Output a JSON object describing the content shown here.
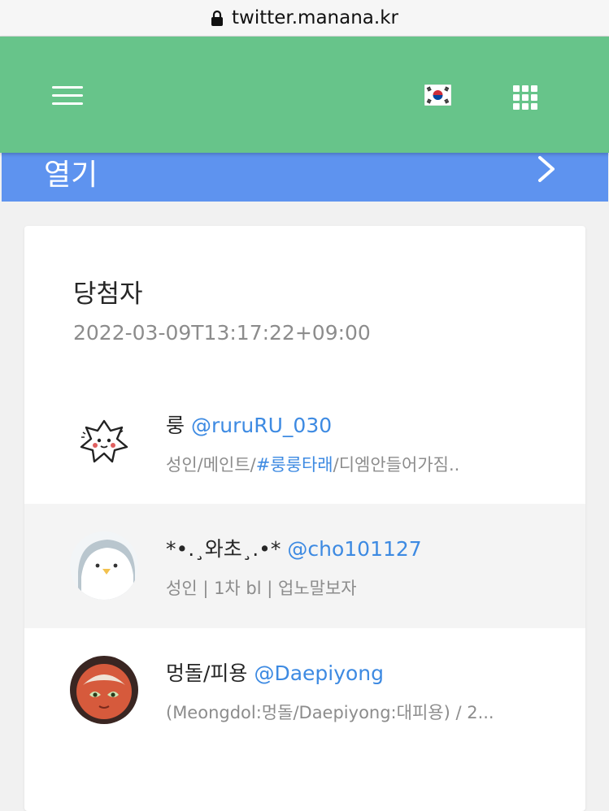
{
  "browser": {
    "url": "twitter.manana.kr"
  },
  "appbar": {
    "menu_icon": "hamburger-menu-icon",
    "flag_icon": "korea-flag-icon",
    "apps_icon": "apps-grid-icon"
  },
  "open_bar": {
    "label": "열기",
    "icon": "chevron-right-icon"
  },
  "winners": {
    "title": "당첨자",
    "timestamp": "2022-03-09T13:17:22+09:00",
    "users": [
      {
        "name": "룽",
        "handle": "@ruruRU_030",
        "bio_before": "성인/메인트/",
        "bio_tag": "#룽룽타래",
        "bio_after": "/디엠안들어가짐.."
      },
      {
        "name": "*•.¸와초¸.•*",
        "handle": "@cho101127",
        "bio": "성인 | 1차 bl | 업노말보자"
      },
      {
        "name": "멍돌/피용",
        "handle": "@Daepiyong",
        "bio": "(Meongdol:멍돌/Daepiyong:대피용) / 2..."
      }
    ]
  },
  "colors": {
    "appbar": "#67c48a",
    "open_bar": "#5e93ef",
    "link": "#3d8ae2"
  }
}
